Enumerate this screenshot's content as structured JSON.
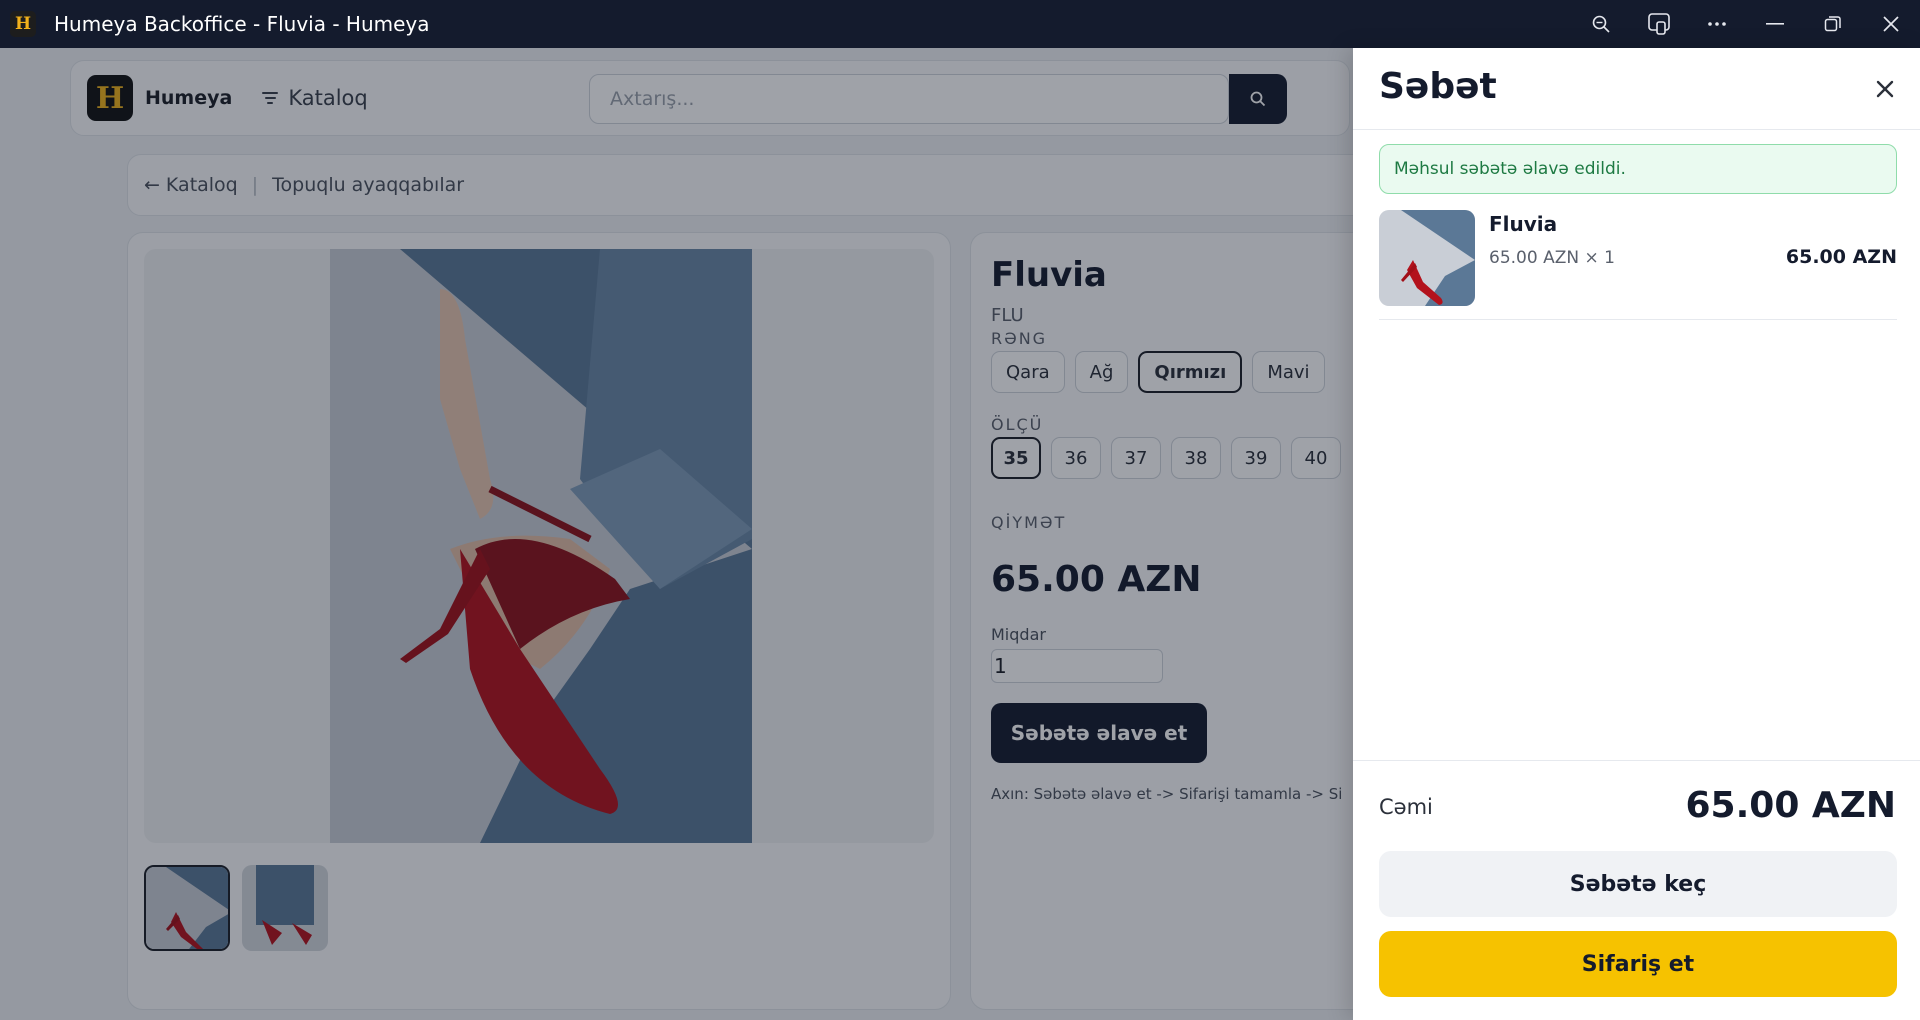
{
  "window": {
    "title": "Humeya Backoffice - Fluvia - Humeya",
    "app_icon_letter": "H",
    "controls": [
      "zoom-icon",
      "cast-icon",
      "more-icon",
      "minimize-icon",
      "restore-icon",
      "close-icon"
    ]
  },
  "header": {
    "logo_letter": "H",
    "brand": "Humeya",
    "catalog_label": "Kataloq",
    "search_placeholder": "Axtarış..."
  },
  "breadcrumb": {
    "back_label": "Kataloq",
    "separator": "|",
    "current": "Topuqlu ayaqqabılar"
  },
  "product": {
    "name": "Fluvia",
    "code": "FLU",
    "color_label": "RƏNG",
    "colors": [
      "Qara",
      "Ağ",
      "Qırmızı",
      "Mavi"
    ],
    "selected_color": "Qırmızı",
    "size_label": "ÖLÇÜ",
    "sizes": [
      "35",
      "36",
      "37",
      "38",
      "39",
      "40"
    ],
    "selected_size": "35",
    "price_label": "QİYMƏT",
    "price": "65.00 AZN",
    "quantity_label": "Miqdar",
    "quantity": "1",
    "add_to_cart_label": "Səbətə əlavə et",
    "flow_text": "Axın: Səbətə əlavə et -> Sifarişi tamamla -> Si"
  },
  "cart": {
    "title": "Səbət",
    "notice": "Məhsul səbətə əlavə edildi.",
    "items": [
      {
        "name": "Fluvia",
        "unit": "65.00 AZN × 1",
        "line_total": "65.00 AZN"
      }
    ],
    "total_label": "Cəmi",
    "total_value": "65.00 AZN",
    "go_to_cart_label": "Səbətə keç",
    "order_label": "Sifariş et"
  },
  "colors": {
    "dark": "#141b2d",
    "accent_yellow": "#f6c200",
    "success_bg": "#eafaf0",
    "success_text": "#1e7a43",
    "shoe_red": "#b3121c",
    "denim": "#5b7896"
  }
}
